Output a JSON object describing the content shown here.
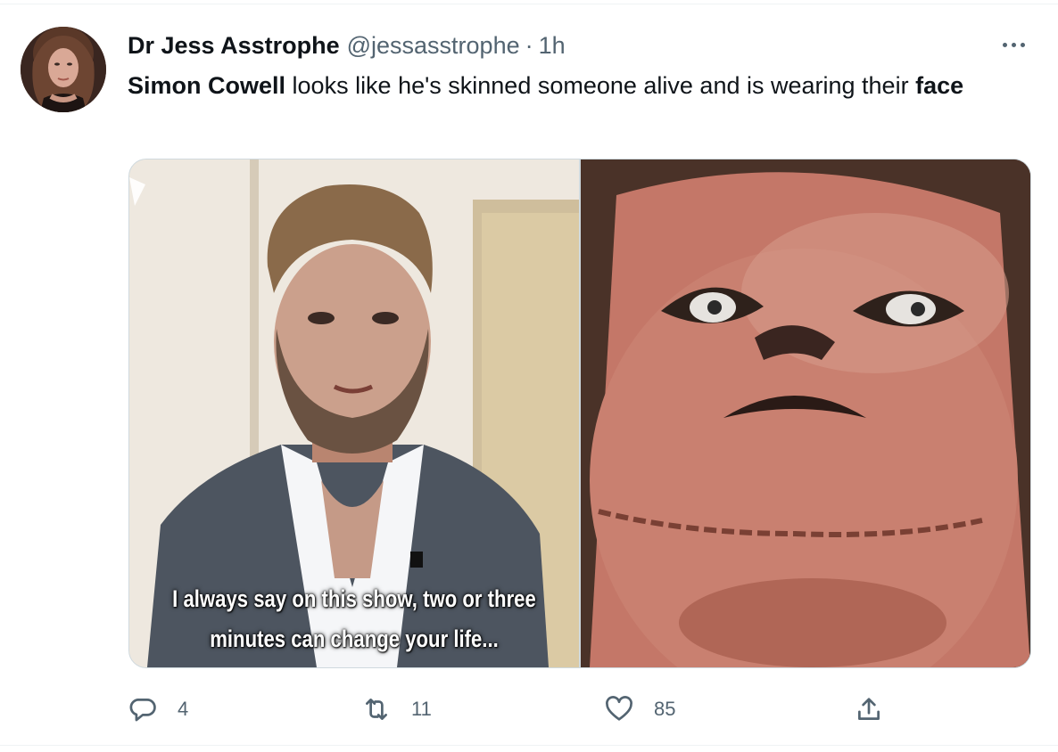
{
  "tweet": {
    "display_name": "Dr Jess Asstrophe",
    "handle": "@jessasstrophe",
    "separator": "·",
    "time": "1h",
    "text_bold_1": "Simon Cowell",
    "text_plain": " looks like he's skinned someone alive and is wearing their ",
    "text_bold_2": "face"
  },
  "media": {
    "left_caption_line1": "I always say on this show, two or three",
    "left_caption_line2": "minutes can change your life..."
  },
  "actions": {
    "reply_count": "4",
    "retweet_count": "11",
    "like_count": "85"
  },
  "icons": {
    "reply": "reply-icon",
    "retweet": "retweet-icon",
    "like": "heart-icon",
    "share": "share-icon",
    "more": "more-icon"
  },
  "colors": {
    "text_primary": "#0f1419",
    "text_secondary": "#536471",
    "border": "#cfd9de"
  }
}
